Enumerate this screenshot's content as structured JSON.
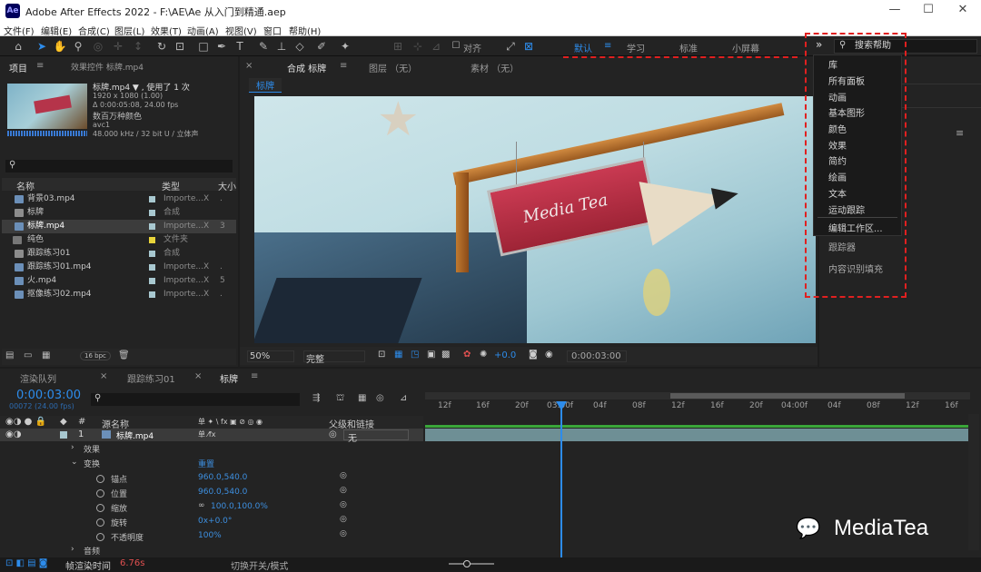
{
  "window": {
    "title": "Adobe After Effects 2022 - F:\\AE\\Ae 从入门到精通.aep",
    "logo": "Ae",
    "minimize": "—",
    "maximize": "☐",
    "close": "✕"
  },
  "menu": [
    "文件(F)",
    "编辑(E)",
    "合成(C)",
    "图层(L)",
    "效果(T)",
    "动画(A)",
    "视图(V)",
    "窗口",
    "帮助(H)"
  ],
  "toolbar": {
    "align": "对齐",
    "workspaces": [
      "默认",
      "学习",
      "标准",
      "小屏幕"
    ],
    "more": "»",
    "search_placeholder": "搜索帮助"
  },
  "project": {
    "tab": "项目",
    "effects_tab": "效果控件 标牌.mp4",
    "clip_name": "标牌.mp4 ▼ , 使用了 1 次",
    "clip_size": "1920 x 1080 (1.00)",
    "clip_dur": "Δ 0:00:05:08, 24.00 fps",
    "clip_color": "数百万种颜色",
    "clip_codec": "avc1",
    "clip_audio": "48.000 kHz / 32 bit U / 立体声",
    "col_name": "名称",
    "col_type": "类型",
    "col_size": "大小",
    "bpc": "16 bpc",
    "items": [
      {
        "name": "背景03.mp4",
        "type": "Importe...X",
        "x": "."
      },
      {
        "name": "标牌",
        "type": "合成",
        "x": ""
      },
      {
        "name": "标牌.mp4",
        "type": "Importe...X",
        "x": "3"
      },
      {
        "name": "纯色",
        "type": "文件夹",
        "x": ""
      },
      {
        "name": "跟踪练习01",
        "type": "合成",
        "x": ""
      },
      {
        "name": "跟踪练习01.mp4",
        "type": "Importe...X",
        "x": "."
      },
      {
        "name": "火.mp4",
        "type": "Importe...X",
        "x": "5"
      },
      {
        "name": "抠像练习02.mp4",
        "type": "Importe...X",
        "x": "."
      }
    ]
  },
  "comp": {
    "tab": "合成 标牌",
    "layer_tab": "图层 （无）",
    "footage_tab": "素材 （无）",
    "crumb": "标牌",
    "zoom": "50%",
    "quality": "完整",
    "exposure": "+0.0",
    "time": "0:00:03:00",
    "sign_text": "Media Tea"
  },
  "dropdown": [
    "库",
    "所有面板",
    "动画",
    "基本图形",
    "颜色",
    "效果",
    "简约",
    "绘画",
    "文本",
    "运动跟踪",
    "编辑工作区..."
  ],
  "right_panel": [
    "跟踪器",
    "内容识别填充"
  ],
  "timeline": {
    "tabs": [
      "渲染队列",
      "跟踪练习01",
      "标牌"
    ],
    "timecode": "0:00:03:00",
    "timecode_sub": "00072 (24.00 fps)",
    "col_source": "源名称",
    "col_switches": "单 ✦ \\ fx ▣ ⊘ ◎ ◉",
    "col_parent": "父级和链接",
    "layer_num": "1",
    "layer_name": "标牌.mp4",
    "parent_val": "无",
    "effects": "效果",
    "transform": "变换",
    "reset": "重置",
    "props": [
      {
        "name": "锚点",
        "value": "960.0,540.0"
      },
      {
        "name": "位置",
        "value": "960.0,540.0"
      },
      {
        "name": "缩放",
        "value": "100.0,100.0%"
      },
      {
        "name": "旋转",
        "value": "0x+0.0°"
      },
      {
        "name": "不透明度",
        "value": "100%"
      }
    ],
    "audio": "音频",
    "render_time_label": "帧渲染时间",
    "render_time": "6.76s",
    "toggle": "切换开关/模式",
    "ruler": [
      "12f",
      "16f",
      "20f",
      "03:00f",
      "04f",
      "08f",
      "12f",
      "16f",
      "20f",
      "04:00f",
      "04f",
      "08f",
      "12f",
      "16f"
    ]
  },
  "watermark": "MediaTea"
}
